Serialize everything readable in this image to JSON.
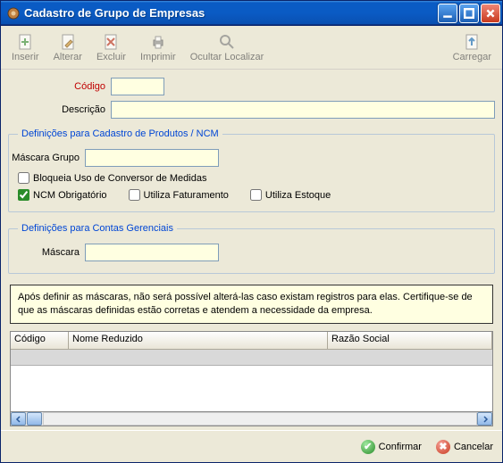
{
  "window": {
    "title": "Cadastro de Grupo de Empresas"
  },
  "toolbar": {
    "inserir": "Inserir",
    "alterar": "Alterar",
    "excluir": "Excluir",
    "imprimir": "Imprimir",
    "ocultar_localizar": "Ocultar Localizar",
    "carregar": "Carregar"
  },
  "form": {
    "codigo_label": "Código",
    "codigo_value": "",
    "descricao_label": "Descrição",
    "descricao_value": ""
  },
  "grp_produtos": {
    "legend": "Definições para Cadastro de Produtos / NCM",
    "mascara_grupo_label": "Máscara Grupo",
    "mascara_grupo_value": "",
    "bloqueia_conversor": "Bloqueia Uso de Conversor de Medidas",
    "ncm_obrigatorio": "NCM Obrigatório",
    "utiliza_faturamento": "Utiliza Faturamento",
    "utiliza_estoque": "Utiliza Estoque"
  },
  "grp_contas": {
    "legend": "Definições para Contas Gerenciais",
    "mascara_label": "Máscara",
    "mascara_value": ""
  },
  "info": "Após definir as máscaras, não será possível alterá-las caso existam registros para elas. Certifique-se de que as máscaras definidas estão corretas e atendem a necessidade da empresa.",
  "grid": {
    "col_codigo": "Código",
    "col_nome": "Nome Reduzido",
    "col_razao": "Razão Social"
  },
  "footer": {
    "confirmar": "Confirmar",
    "cancelar": "Cancelar"
  }
}
